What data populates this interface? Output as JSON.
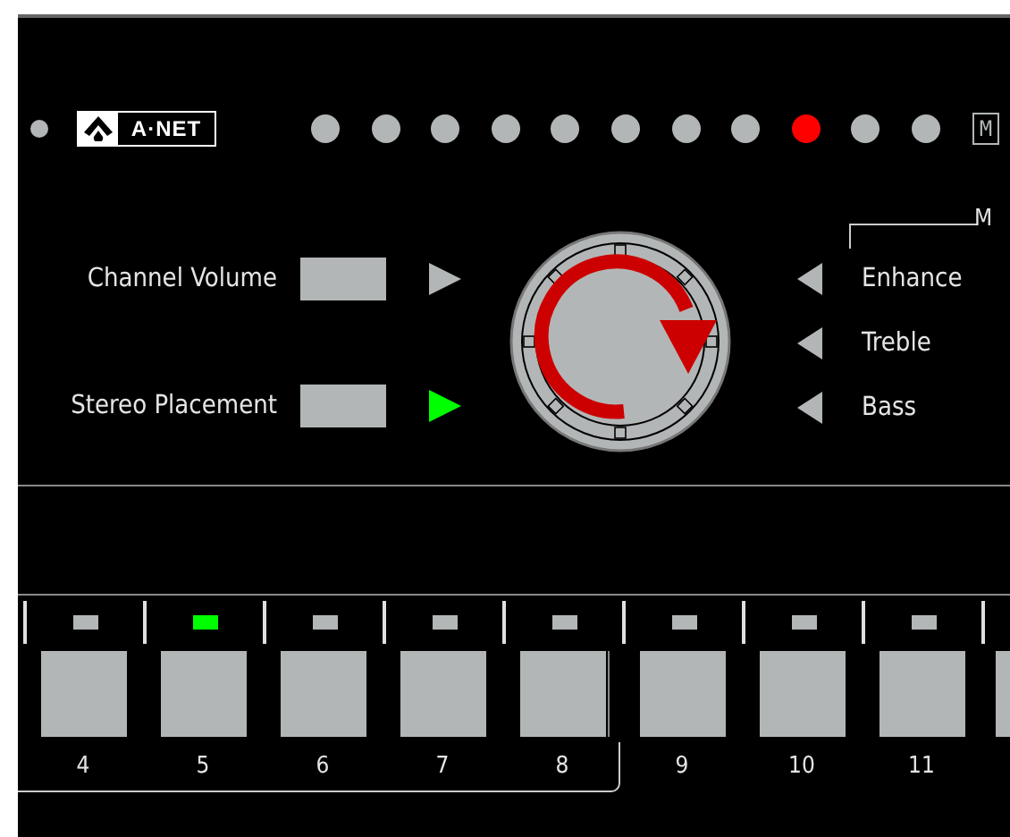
{
  "top_bar": {
    "logo_text": "A·NET",
    "indicators": [
      {
        "on": false
      },
      {
        "on": false
      },
      {
        "on": false
      },
      {
        "on": false
      },
      {
        "on": false
      },
      {
        "on": false
      },
      {
        "on": false
      },
      {
        "on": false
      },
      {
        "on": true
      },
      {
        "on": false
      },
      {
        "on": false
      }
    ],
    "mode_badge": "M"
  },
  "left_controls": [
    {
      "label": "Channel Volume",
      "arrow_active": false
    },
    {
      "label": "Stereo Placement",
      "arrow_active": true
    }
  ],
  "right_controls": [
    {
      "label": "Enhance",
      "arrow_active": false
    },
    {
      "label": "Treble",
      "arrow_active": false
    },
    {
      "label": "Bass",
      "arrow_active": false
    }
  ],
  "right_group_label": "M",
  "channels": [
    {
      "number": "4",
      "led_on": false
    },
    {
      "number": "5",
      "led_on": true
    },
    {
      "number": "6",
      "led_on": false
    },
    {
      "number": "7",
      "led_on": false
    },
    {
      "number": "8",
      "led_on": false
    },
    {
      "number": "9",
      "led_on": false
    },
    {
      "number": "10",
      "led_on": false
    },
    {
      "number": "11",
      "led_on": false
    }
  ],
  "strip_continues": true
}
